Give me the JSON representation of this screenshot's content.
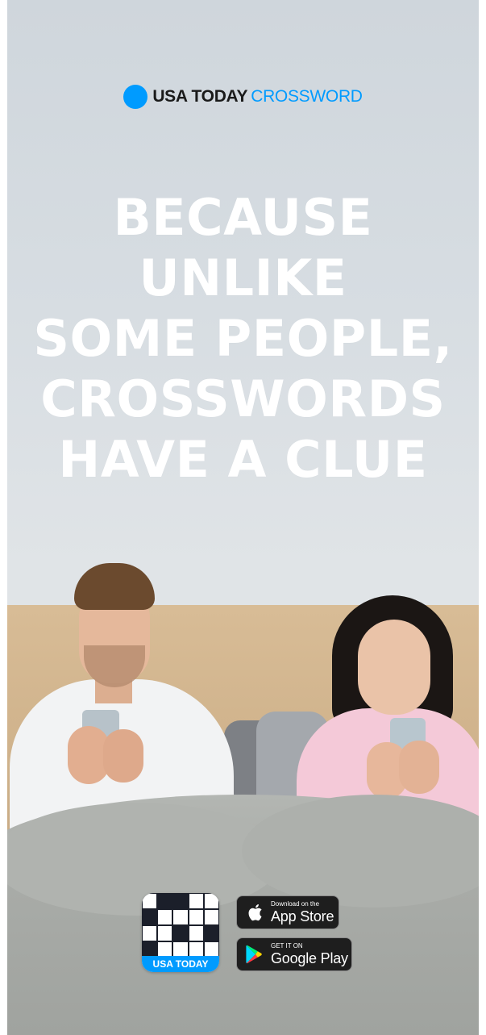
{
  "logo": {
    "brand": "USA TODAY",
    "product": "CROSSWORD",
    "accent_color": "#009bff"
  },
  "headline": {
    "lines": [
      "BECAUSE",
      "UNLIKE",
      "SOME PEOPLE,",
      "CROSSWORDS",
      "HAVE A CLUE"
    ]
  },
  "app_icon": {
    "label": "USA TODAY",
    "icon": "crossword-grid-icon"
  },
  "store_badges": {
    "apple": {
      "small": "Download on the",
      "big": "App Store",
      "icon": "apple-icon"
    },
    "google": {
      "small": "GET IT ON",
      "big": "Google Play",
      "icon": "google-play-icon"
    }
  }
}
